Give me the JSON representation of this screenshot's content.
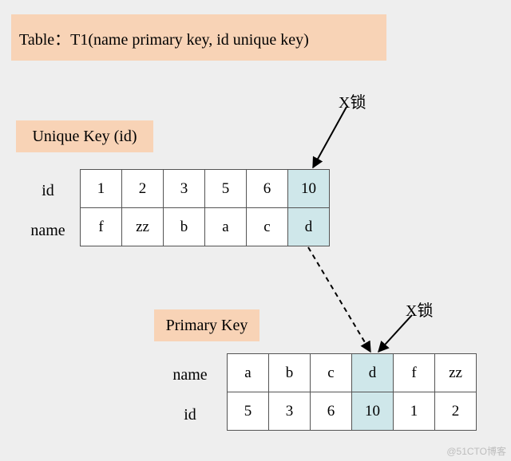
{
  "header": "Table：T1(name primary key, id unique key)",
  "labels": {
    "unique": "Unique Key (id)",
    "primary": "Primary Key",
    "id": "id",
    "name": "name",
    "xlock": "X锁"
  },
  "uniqueKey": {
    "id": [
      "1",
      "2",
      "3",
      "5",
      "6",
      "10"
    ],
    "name": [
      "f",
      "zz",
      "b",
      "a",
      "c",
      "d"
    ],
    "lockedIndex": 5
  },
  "primaryKey": {
    "name": [
      "a",
      "b",
      "c",
      "d",
      "f",
      "zz"
    ],
    "id": [
      "5",
      "3",
      "6",
      "10",
      "1",
      "2"
    ],
    "lockedIndex": 3
  },
  "watermark": "@51CTO博客"
}
